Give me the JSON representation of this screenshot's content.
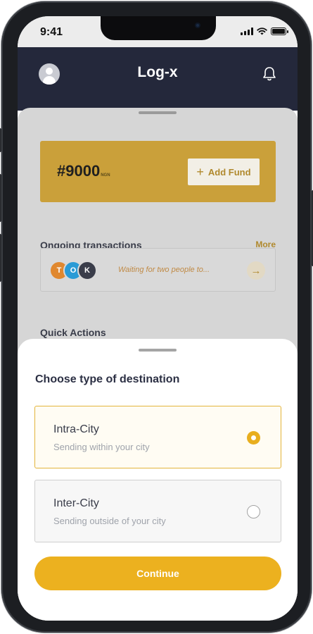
{
  "status_bar": {
    "time": "9:41"
  },
  "header": {
    "title": "Log-x"
  },
  "fund": {
    "balance": "#9000",
    "currency": "NGN",
    "add_fund_label": "Add Fund"
  },
  "ongoing": {
    "title": "Ongoing transactions",
    "more_label": "More",
    "participants": [
      {
        "initial": "T",
        "color": "#e0882f"
      },
      {
        "initial": "O",
        "color": "#2a9bd6"
      },
      {
        "initial": "K",
        "color": "#3a3d4a"
      }
    ],
    "status_text": "Waiting for two people to..."
  },
  "quick_actions": {
    "title": "Quick Actions"
  },
  "sheet": {
    "title": "Choose type of destination",
    "options": [
      {
        "title": "Intra-City",
        "subtitle": "Sending within your city",
        "selected": true
      },
      {
        "title": "Inter-City",
        "subtitle": "Sending outside of your city",
        "selected": false
      }
    ],
    "continue_label": "Continue"
  },
  "colors": {
    "accent": "#ecb11f",
    "header_bg": "#24283b",
    "card_gold": "#caa03a"
  },
  "icons": [
    "avatar-icon",
    "bell-icon",
    "plus-icon",
    "arrow-right-icon",
    "signal-icon",
    "wifi-icon",
    "battery-icon"
  ]
}
